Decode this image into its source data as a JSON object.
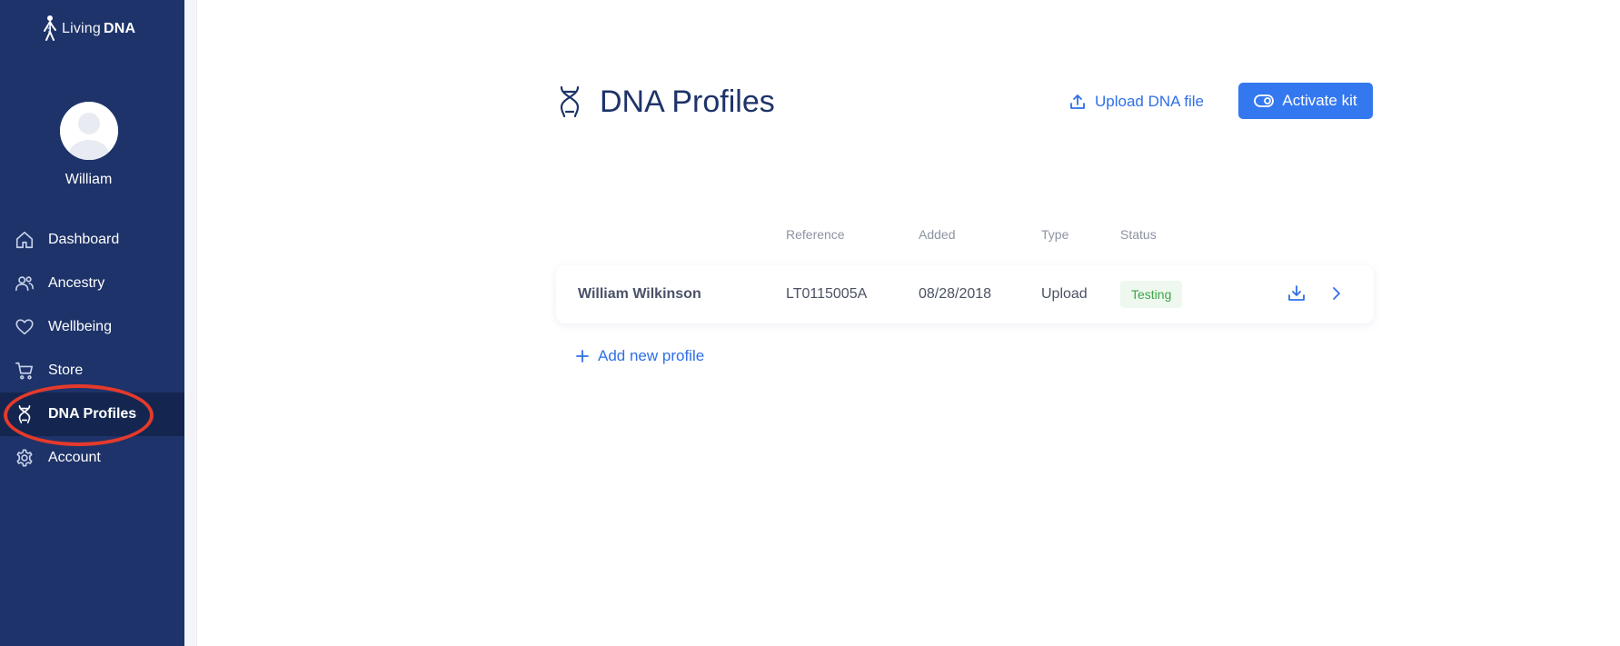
{
  "brand": {
    "logo_light": "Living",
    "logo_bold": "DNA"
  },
  "user": {
    "name": "William"
  },
  "sidebar": {
    "items": [
      {
        "label": "Dashboard",
        "icon": "home-icon"
      },
      {
        "label": "Ancestry",
        "icon": "people-icon"
      },
      {
        "label": "Wellbeing",
        "icon": "heart-icon"
      },
      {
        "label": "Store",
        "icon": "cart-icon"
      },
      {
        "label": "DNA Profiles",
        "icon": "dna-icon",
        "active": true
      },
      {
        "label": "Account",
        "icon": "gear-icon"
      }
    ]
  },
  "header": {
    "title": "DNA Profiles",
    "title_icon": "dna-icon",
    "upload_label": "Upload DNA file",
    "activate_label": "Activate kit"
  },
  "table": {
    "columns": [
      "Reference",
      "Added",
      "Type",
      "Status"
    ],
    "rows": [
      {
        "name": "William Wilkinson",
        "reference": "LT0115005A",
        "added": "08/28/2018",
        "type": "Upload",
        "status": "Testing"
      }
    ]
  },
  "add_profile_label": "Add new profile",
  "colors": {
    "sidebar": "#1e3369",
    "sidebar_active": "#142650",
    "accent": "#3478f0",
    "status_green": "#3ea54a",
    "highlight_ring": "#e53a2b"
  }
}
